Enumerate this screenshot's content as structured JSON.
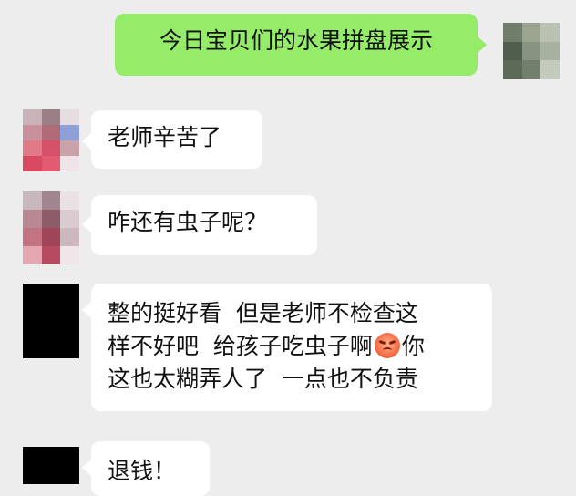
{
  "messages": [
    {
      "side": "right",
      "text": "今日宝贝们的水果拼盘展示"
    },
    {
      "side": "left",
      "text": "老师辛苦了"
    },
    {
      "side": "left",
      "text": "咋还有虫子呢？"
    },
    {
      "side": "left",
      "line1": "整的挺好看  但是老师不检查这",
      "line2a": "样不好吧  给孩子吃虫子啊",
      "emoji": "angry-face-emoji",
      "line2b": "你",
      "line3": "这也太糊弄人了  一点也不负责"
    },
    {
      "side": "left",
      "text": "退钱！"
    }
  ],
  "colors": {
    "background": "#ededed",
    "bubble_sent": "#95ec69",
    "bubble_received": "#ffffff"
  }
}
